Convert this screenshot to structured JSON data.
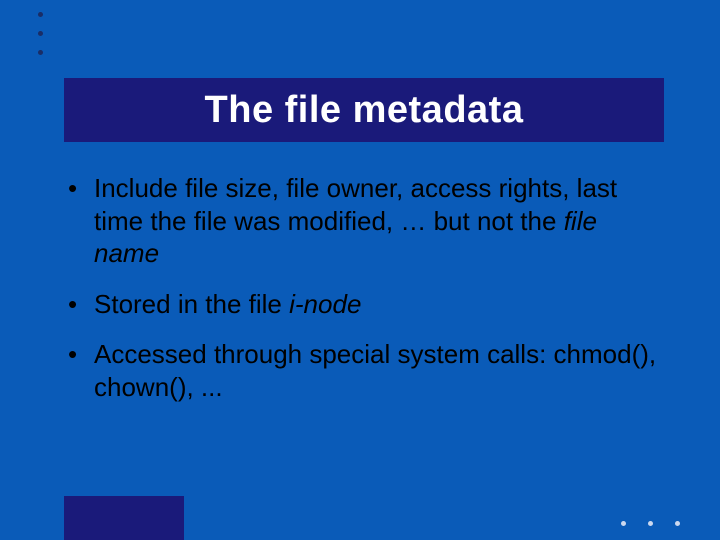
{
  "title": "The file metadata",
  "bullets": [
    {
      "pre": "Include file size, file owner, access rights, last time the file was modified, … but not the ",
      "emph": "file name",
      "post": ""
    },
    {
      "pre": "Stored in the file ",
      "emph": "i-node",
      "post": ""
    },
    {
      "pre": "Accessed through special system calls: chmod(), chown(), ...",
      "emph": "",
      "post": ""
    }
  ],
  "bullet_marker": "•"
}
